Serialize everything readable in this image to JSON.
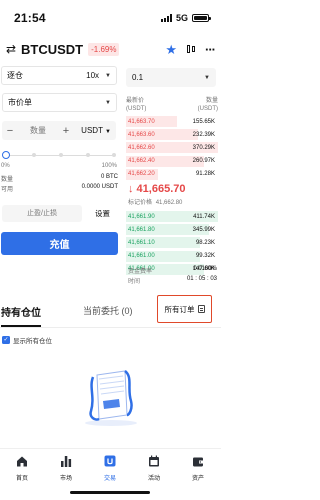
{
  "status_bar": {
    "time": "21:54",
    "network": "5G"
  },
  "header": {
    "pair": "BTCUSDT",
    "change": "-1.69%",
    "icons": [
      "swap-arrows-icon",
      "star-icon",
      "candlestick-chart-icon",
      "more-dots-icon"
    ]
  },
  "order_form": {
    "margin_mode": "逐仓",
    "leverage": "10x",
    "order_type": "市价单",
    "qty_minus": "−",
    "qty_placeholder": "数量",
    "qty_plus": "+",
    "qty_unit": "USDT",
    "slider_value_pct": 0,
    "slider_min": "0%",
    "slider_max": "100%",
    "quantity_label": "数量",
    "quantity_value": "0 BTC",
    "available_label": "可用",
    "available_value": "0.0000 USDT",
    "tp_sl_placeholder": "止盈/止损",
    "settings_label": "设置",
    "deposit_button": "充值"
  },
  "orderbook": {
    "precision": "0.1",
    "price_header": "最新价",
    "price_unit": "(USDT)",
    "qty_header": "数量",
    "qty_unit": "(USDT)",
    "asks": [
      {
        "price": "41,663.70",
        "qty": "155.65K",
        "depth": 0.55
      },
      {
        "price": "41,663.60",
        "qty": "232.39K",
        "depth": 0.78
      },
      {
        "price": "41,662.60",
        "qty": "370.29K",
        "depth": 1.0
      },
      {
        "price": "41,662.40",
        "qty": "260.97K",
        "depth": 0.85
      },
      {
        "price": "41,662.20",
        "qty": "91.28K",
        "depth": 0.35
      }
    ],
    "last_price": "↓ 41,665.70",
    "mark_price_label": "标记价格",
    "mark_price": "41,662.80",
    "bids": [
      {
        "price": "41,661.90",
        "qty": "411.74K",
        "depth": 1.0
      },
      {
        "price": "41,661.80",
        "qty": "345.99K",
        "depth": 0.9
      },
      {
        "price": "41,661.10",
        "qty": "98.23K",
        "depth": 0.8
      },
      {
        "price": "41,661.00",
        "qty": "99.32K",
        "depth": 0.8
      },
      {
        "price": "41,661.00",
        "qty": "147.60K",
        "depth": 0.85
      }
    ],
    "funding_rate_label": "资金费率",
    "funding_rate": "0.0100%",
    "countdown_label": "时间",
    "countdown": "01 : 05 : 03"
  },
  "positions": {
    "tab_positions": "持有仓位",
    "tab_orders": "当前委托 (0)",
    "all_orders": "所有订单",
    "show_all_label": "显示所有仓位"
  },
  "bottom_nav": [
    {
      "label": "首页",
      "icon": "home-icon"
    },
    {
      "label": "市场",
      "icon": "bar-chart-icon"
    },
    {
      "label": "交易",
      "icon": "trade-icon",
      "active": true
    },
    {
      "label": "活动",
      "icon": "calendar-icon"
    },
    {
      "label": "资产",
      "icon": "wallet-icon"
    }
  ],
  "colors": {
    "accent": "#2f6fe6",
    "ask": "#e54848",
    "bid": "#1aa260",
    "highlight_border": "#e0492a"
  }
}
